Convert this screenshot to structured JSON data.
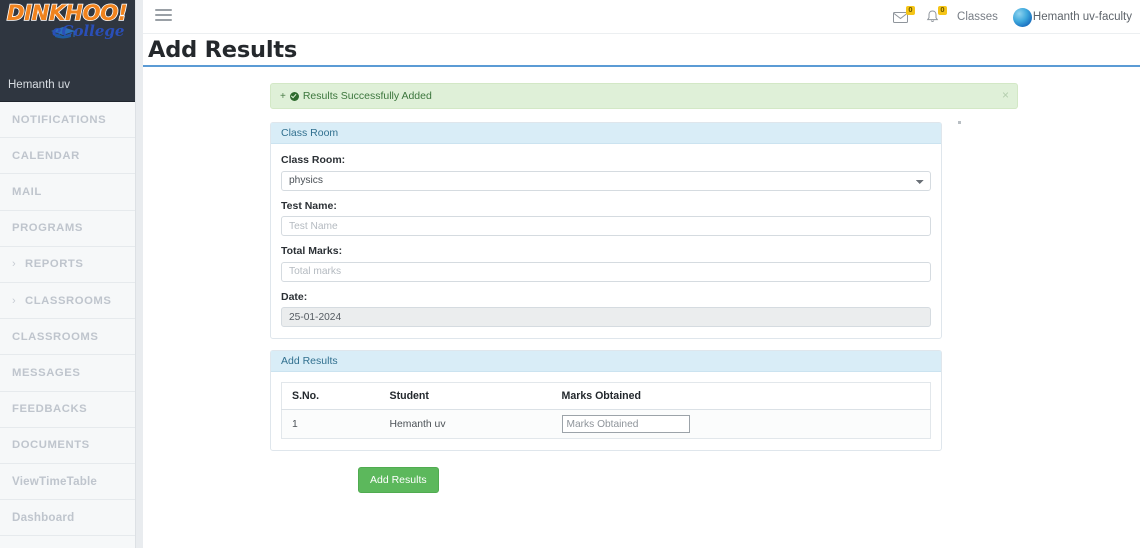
{
  "brand": {
    "logo_main": "DINKHOO!",
    "logo_sub": "eCollege",
    "cap_icon": "graduation-cap-icon",
    "user": "Hemanth uv"
  },
  "sidebar": {
    "items": [
      {
        "label": "NOTIFICATIONS",
        "expandable": false
      },
      {
        "label": "CALENDAR",
        "expandable": false
      },
      {
        "label": "MAIL",
        "expandable": false
      },
      {
        "label": "PROGRAMS",
        "expandable": false
      },
      {
        "label": "REPORTS",
        "expandable": true,
        "caret": "›"
      },
      {
        "label": "CLASSROOMS",
        "expandable": true,
        "caret": "›"
      },
      {
        "label": "CLASSROOMS",
        "expandable": false
      },
      {
        "label": "MESSAGES",
        "expandable": false
      },
      {
        "label": "FEEDBACKS",
        "expandable": false
      },
      {
        "label": "DOCUMENTS",
        "expandable": false
      },
      {
        "label": "ViewTimeTable",
        "expandable": false,
        "mixedcase": true
      },
      {
        "label": "Dashboard",
        "expandable": false,
        "mixedcase": true
      }
    ]
  },
  "topbar": {
    "menu_toggle_icon": "hamburger-icon",
    "mail_icon": "envelope-icon",
    "mail_badge": "0",
    "bell_icon": "bell-icon",
    "bell_badge": "0",
    "classes_link": "Classes",
    "avatar_icon": "user-avatar",
    "username": "Hemanth uv-faculty"
  },
  "page": {
    "title": "Add Results"
  },
  "alert": {
    "prefix": "+",
    "icon": "check-circle-icon",
    "message": "Results Successfully Added",
    "close_label": "×"
  },
  "classroom_panel": {
    "heading": "Class Room",
    "classroom_label": "Class Room:",
    "classroom_value": "physics",
    "classroom_options": [
      "physics"
    ],
    "testname_label": "Test Name:",
    "testname_value": "",
    "testname_placeholder": "Test Name",
    "totalmarks_label": "Total Marks:",
    "totalmarks_value": "",
    "totalmarks_placeholder": "Total marks",
    "date_label": "Date:",
    "date_value": "25-01-2024"
  },
  "results_panel": {
    "heading": "Add Results",
    "columns": [
      "S.No.",
      "Student",
      "Marks Obtained"
    ],
    "rows": [
      {
        "sno": "1",
        "student": "Hemanth uv",
        "marks_value": "",
        "marks_placeholder": "Marks Obtained"
      }
    ]
  },
  "submit": {
    "label": "Add Results"
  },
  "colors": {
    "accent_blue": "#5b9bd5",
    "panel_head_bg": "#d9edf7",
    "panel_head_text": "#31708f",
    "alert_bg": "#dff0d8",
    "alert_text": "#3c763d",
    "success_green": "#5cb85c",
    "sidebar_dark": "#2f3640",
    "badge_yellow": "#f5c518",
    "logo_orange": "#f0831e",
    "logo_blue": "#2a4fb8"
  }
}
